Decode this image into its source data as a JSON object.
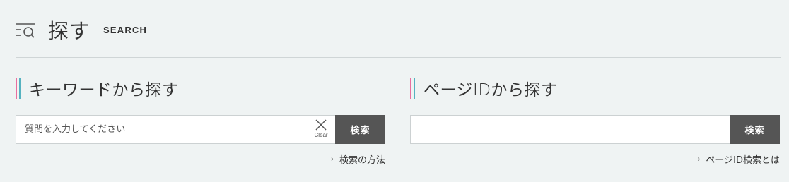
{
  "header": {
    "title": "探す",
    "subtitle": "SEARCH",
    "icon": "search-list-icon"
  },
  "keyword_search": {
    "heading": "キーワードから探す",
    "placeholder": "質問を入力してください",
    "value": "",
    "clear_label": "Clear",
    "button_label": "検索",
    "help_link": "検索の方法",
    "help_icon": "arrow-right-icon"
  },
  "pageid_search": {
    "heading": "ページIDから探す",
    "placeholder": "",
    "value": "",
    "button_label": "検索",
    "help_link": "ページID検索とは",
    "help_icon": "arrow-right-icon"
  },
  "colors": {
    "background": "#eff3f3",
    "accent_pink": "#e96ea0",
    "accent_teal": "#55b2c0",
    "button": "#555555"
  }
}
